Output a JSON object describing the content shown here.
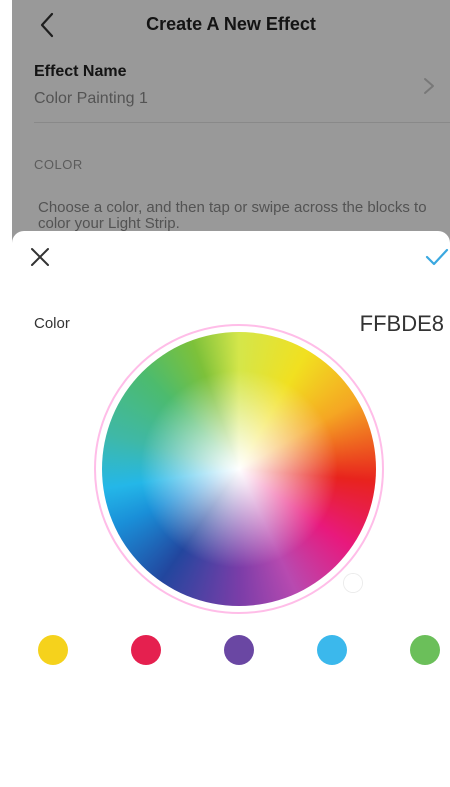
{
  "background_screen": {
    "title": "Create A New Effect",
    "effect_name_label": "Effect Name",
    "effect_name_value": "Color Painting 1",
    "section_label": "COLOR",
    "instruction": "Choose a color, and then tap or swipe across the blocks to color your Light Strip."
  },
  "color_picker": {
    "label": "Color",
    "hex_value": "FFBDE8",
    "accent_color": "#3aa8e0",
    "presets": [
      {
        "name": "yellow",
        "color": "#f5d21c"
      },
      {
        "name": "crimson",
        "color": "#e5204f"
      },
      {
        "name": "purple",
        "color": "#6a47a3"
      },
      {
        "name": "sky-blue",
        "color": "#3bb8ec"
      },
      {
        "name": "green",
        "color": "#6bbf5a"
      }
    ]
  },
  "icons": {
    "back": "chevron-left-icon",
    "chevron": "chevron-right-icon",
    "close": "close-icon",
    "confirm": "checkmark-icon"
  }
}
